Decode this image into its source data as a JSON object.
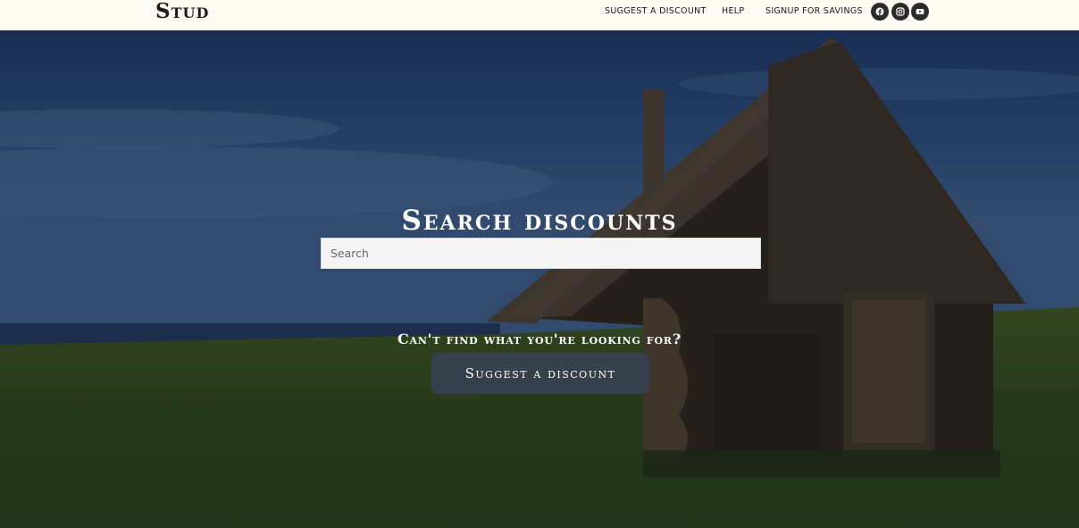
{
  "header": {
    "logo": "Stud",
    "nav": {
      "suggest": "SUGGEST A DISCOUNT",
      "help": "HELP",
      "signup": "SIGNUP FOR SAVINGS"
    },
    "social": [
      "facebook-icon",
      "instagram-icon",
      "youtube-icon"
    ]
  },
  "hero": {
    "title": "Search discounts",
    "search_placeholder": "Search",
    "cta_text": "Can't find what you're looking for?",
    "cta_button": "Suggest a discount"
  },
  "colors": {
    "header_bg": "#fffbf2",
    "button_bg": "#37414d",
    "icon_bg": "#2b2b2b"
  }
}
